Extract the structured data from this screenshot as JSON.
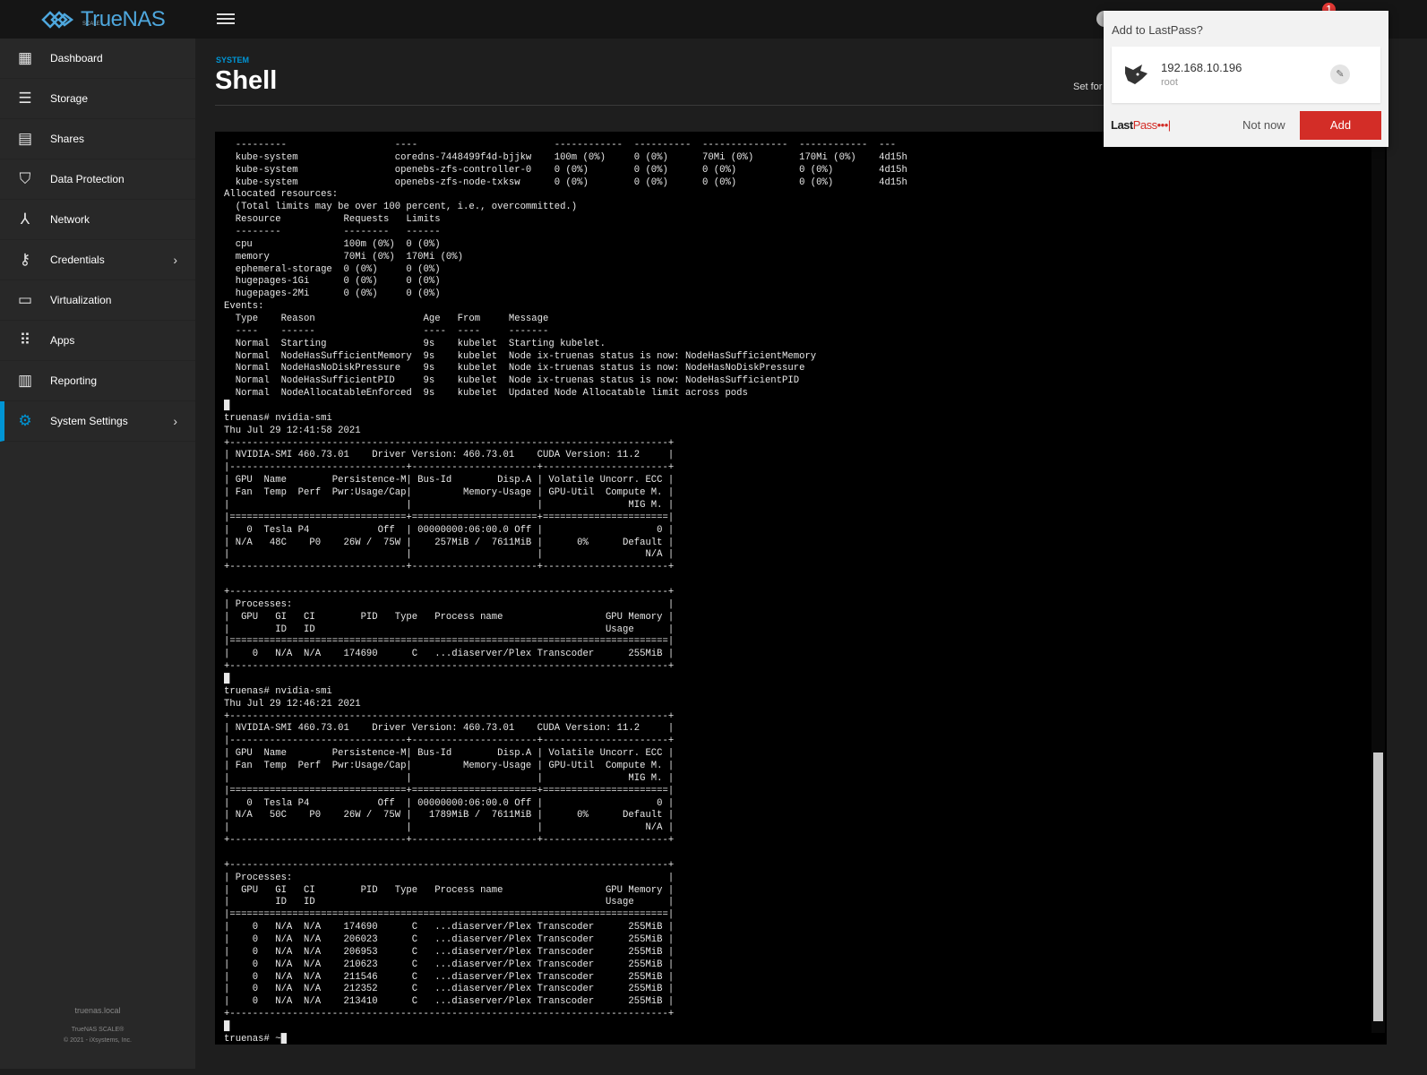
{
  "header": {
    "logo_text": "TrueNAS",
    "logo_sub": "SCALE",
    "notification_count": "1"
  },
  "sidebar": {
    "items": [
      {
        "label": "Dashboard",
        "icon": "dashboard-icon",
        "glyph": "▦"
      },
      {
        "label": "Storage",
        "icon": "storage-icon",
        "glyph": "☰"
      },
      {
        "label": "Shares",
        "icon": "shares-icon",
        "glyph": "▤"
      },
      {
        "label": "Data Protection",
        "icon": "shield-icon",
        "glyph": "⛉"
      },
      {
        "label": "Network",
        "icon": "network-icon",
        "glyph": "⅄"
      },
      {
        "label": "Credentials",
        "icon": "key-icon",
        "glyph": "⚷"
      },
      {
        "label": "Virtualization",
        "icon": "laptop-icon",
        "glyph": "▭"
      },
      {
        "label": "Apps",
        "icon": "apps-grid-icon",
        "glyph": "⠿"
      },
      {
        "label": "Reporting",
        "icon": "reporting-icon",
        "glyph": "▥"
      },
      {
        "label": "System Settings",
        "icon": "gear-icon",
        "glyph": "⚙"
      }
    ],
    "hostname": "truenas.local",
    "product": "TrueNAS SCALE®",
    "copyright": "© 2021 - iXsystems, Inc."
  },
  "page": {
    "section": "SYSTEM",
    "title": "Shell",
    "set_font_label": "Set for"
  },
  "terminal": {
    "lines": [
      "  ---------                   ----                        ------------  ----------  ---------------  ------------  ---",
      "  kube-system                 coredns-7448499f4d-bjjkw    100m (0%)     0 (0%)      70Mi (0%)        170Mi (0%)    4d15h",
      "  kube-system                 openebs-zfs-controller-0    0 (0%)        0 (0%)      0 (0%)           0 (0%)        4d15h",
      "  kube-system                 openebs-zfs-node-txksw      0 (0%)        0 (0%)      0 (0%)           0 (0%)        4d15h",
      "Allocated resources:",
      "  (Total limits may be over 100 percent, i.e., overcommitted.)",
      "  Resource           Requests   Limits",
      "  --------           --------   ------",
      "  cpu                100m (0%)  0 (0%)",
      "  memory             70Mi (0%)  170Mi (0%)",
      "  ephemeral-storage  0 (0%)     0 (0%)",
      "  hugepages-1Gi      0 (0%)     0 (0%)",
      "  hugepages-2Mi      0 (0%)     0 (0%)",
      "Events:",
      "  Type    Reason                   Age   From     Message",
      "  ----    ------                   ----  ----     -------",
      "  Normal  Starting                 9s    kubelet  Starting kubelet.",
      "  Normal  NodeHasSufficientMemory  9s    kubelet  Node ix-truenas status is now: NodeHasSufficientMemory",
      "  Normal  NodeHasNoDiskPressure    9s    kubelet  Node ix-truenas status is now: NodeHasNoDiskPressure",
      "  Normal  NodeHasSufficientPID     9s    kubelet  Node ix-truenas status is now: NodeHasSufficientPID",
      "  Normal  NodeAllocatableEnforced  9s    kubelet  Updated Node Allocatable limit across pods",
      "█",
      "truenas# nvidia-smi",
      "Thu Jul 29 12:41:58 2021",
      "+-----------------------------------------------------------------------------+",
      "| NVIDIA-SMI 460.73.01    Driver Version: 460.73.01    CUDA Version: 11.2     |",
      "|-------------------------------+----------------------+----------------------+",
      "| GPU  Name        Persistence-M| Bus-Id        Disp.A | Volatile Uncorr. ECC |",
      "| Fan  Temp  Perf  Pwr:Usage/Cap|         Memory-Usage | GPU-Util  Compute M. |",
      "|                               |                      |               MIG M. |",
      "|===============================+======================+======================|",
      "|   0  Tesla P4            Off  | 00000000:06:00.0 Off |                    0 |",
      "| N/A   48C    P0    26W /  75W |    257MiB /  7611MiB |      0%      Default |",
      "|                               |                      |                  N/A |",
      "+-------------------------------+----------------------+----------------------+",
      "",
      "+-----------------------------------------------------------------------------+",
      "| Processes:                                                                  |",
      "|  GPU   GI   CI        PID   Type   Process name                  GPU Memory |",
      "|        ID   ID                                                   Usage      |",
      "|=============================================================================|",
      "|    0   N/A  N/A    174690      C   ...diaserver/Plex Transcoder      255MiB |",
      "+-----------------------------------------------------------------------------+",
      "█",
      "truenas# nvidia-smi",
      "Thu Jul 29 12:46:21 2021",
      "+-----------------------------------------------------------------------------+",
      "| NVIDIA-SMI 460.73.01    Driver Version: 460.73.01    CUDA Version: 11.2     |",
      "|-------------------------------+----------------------+----------------------+",
      "| GPU  Name        Persistence-M| Bus-Id        Disp.A | Volatile Uncorr. ECC |",
      "| Fan  Temp  Perf  Pwr:Usage/Cap|         Memory-Usage | GPU-Util  Compute M. |",
      "|                               |                      |               MIG M. |",
      "|===============================+======================+======================|",
      "|   0  Tesla P4            Off  | 00000000:06:00.0 Off |                    0 |",
      "| N/A   50C    P0    26W /  75W |   1789MiB /  7611MiB |      0%      Default |",
      "|                               |                      |                  N/A |",
      "+-------------------------------+----------------------+----------------------+",
      "",
      "+-----------------------------------------------------------------------------+",
      "| Processes:                                                                  |",
      "|  GPU   GI   CI        PID   Type   Process name                  GPU Memory |",
      "|        ID   ID                                                   Usage      |",
      "|=============================================================================|",
      "|    0   N/A  N/A    174690      C   ...diaserver/Plex Transcoder      255MiB |",
      "|    0   N/A  N/A    206023      C   ...diaserver/Plex Transcoder      255MiB |",
      "|    0   N/A  N/A    206953      C   ...diaserver/Plex Transcoder      255MiB |",
      "|    0   N/A  N/A    210623      C   ...diaserver/Plex Transcoder      255MiB |",
      "|    0   N/A  N/A    211546      C   ...diaserver/Plex Transcoder      255MiB |",
      "|    0   N/A  N/A    212352      C   ...diaserver/Plex Transcoder      255MiB |",
      "|    0   N/A  N/A    213410      C   ...diaserver/Plex Transcoder      255MiB |",
      "+-----------------------------------------------------------------------------+",
      "█",
      "truenas# ~█"
    ]
  },
  "lastpass": {
    "title": "Add to LastPass?",
    "site": "192.168.10.196",
    "username": "root",
    "brand_last": "Last",
    "brand_pass": "Pass•••|",
    "not_now_label": "Not now",
    "add_label": "Add",
    "accent_color": "#d32d27"
  }
}
